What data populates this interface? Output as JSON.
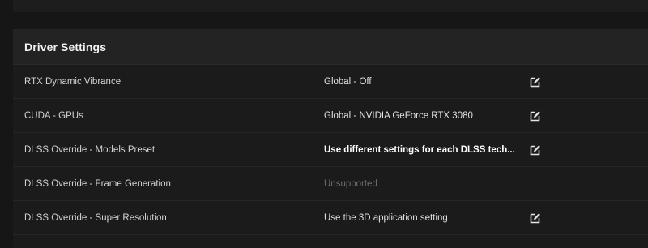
{
  "panel": {
    "title": "Driver Settings"
  },
  "settings": [
    {
      "label": "RTX Dynamic Vibrance",
      "value": "Global - Off",
      "editable": true,
      "style": "normal",
      "icon": "edit-icon"
    },
    {
      "label": "CUDA - GPUs",
      "value": "Global - NVIDIA GeForce RTX 3080",
      "editable": true,
      "style": "normal",
      "icon": "edit-icon"
    },
    {
      "label": "DLSS Override - Models Preset",
      "value": "Use different settings for each DLSS tech...",
      "editable": true,
      "style": "bold",
      "icon": "edit-icon"
    },
    {
      "label": "DLSS Override - Frame Generation",
      "value": "Unsupported",
      "editable": false,
      "style": "muted"
    },
    {
      "label": "DLSS Override - Super Resolution",
      "value": "Use the 3D application setting",
      "editable": true,
      "style": "normal",
      "icon": "edit-icon"
    }
  ],
  "colors": {
    "background": "#161616",
    "panel": "#1b1b1b",
    "header": "#232323",
    "text": "#d4d4d4",
    "muted": "#6e6e6e",
    "icon": "#e6e6e6"
  }
}
